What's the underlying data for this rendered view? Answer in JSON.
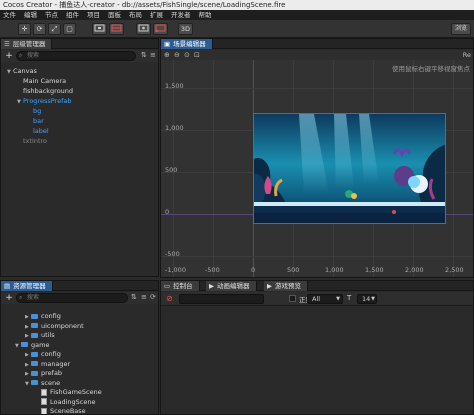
{
  "window": {
    "title": "Cocos Creator - 捕鱼达人-creator - db://assets/FishSingle/scene/LoadingScene.fire"
  },
  "menu": [
    "文件",
    "编辑",
    "节点",
    "组件",
    "项目",
    "面板",
    "布局",
    "扩展",
    "开发者",
    "帮助"
  ],
  "toolbar": {
    "move_icon": "✛",
    "rotate_icon": "⟳",
    "scale_icon": "⤢",
    "rect_icon": "▢",
    "mode_3d_label": "3D",
    "open_label": "浏览"
  },
  "hierarchy": {
    "tab_label": "层级管理器",
    "search_placeholder": "搜索",
    "items": [
      {
        "label": "Canvas",
        "level": 1,
        "expanded": true,
        "color": "white"
      },
      {
        "label": "Main Camera",
        "level": 2,
        "color": "white"
      },
      {
        "label": "fishbackground",
        "level": 2,
        "color": "white"
      },
      {
        "label": "ProgressPrefab",
        "level": 2,
        "expanded": true,
        "color": "blue"
      },
      {
        "label": "bg",
        "level": 3,
        "color": "blue"
      },
      {
        "label": "bar",
        "level": 3,
        "color": "blue"
      },
      {
        "label": "label",
        "level": 3,
        "color": "blue"
      },
      {
        "label": "txtIntro",
        "level": 2,
        "color": "grey"
      }
    ]
  },
  "scene": {
    "tab_label": "场景编辑器",
    "hint": "使用鼠标右键平移视窗焦点",
    "tool_hint": "Re",
    "y_labels": [
      "1,500",
      "1,000",
      "500",
      "0",
      "-500"
    ],
    "x_labels": [
      "-1,000",
      "-500",
      "0",
      "500",
      "1,000",
      "1,500",
      "2,000",
      "2,500"
    ]
  },
  "assets": {
    "tab_label": "资源管理器",
    "search_placeholder": "搜索",
    "items": [
      {
        "label": "config",
        "level": 2,
        "type": "folder"
      },
      {
        "label": "uicomponent",
        "level": 2,
        "type": "folder"
      },
      {
        "label": "utils",
        "level": 2,
        "type": "folder"
      },
      {
        "label": "game",
        "level": 1,
        "type": "folder",
        "expanded": true
      },
      {
        "label": "config",
        "level": 2,
        "type": "folder"
      },
      {
        "label": "manager",
        "level": 2,
        "type": "folder"
      },
      {
        "label": "prefab",
        "level": 2,
        "type": "folder"
      },
      {
        "label": "scene",
        "level": 2,
        "type": "folder",
        "expanded": true
      },
      {
        "label": "FishGameScene",
        "level": 3,
        "type": "scene"
      },
      {
        "label": "LoadingScene",
        "level": 3,
        "type": "scene"
      },
      {
        "label": "SceneBase",
        "level": 3,
        "type": "scene"
      }
    ]
  },
  "bottom_tabs": {
    "console": "控制台",
    "animation": "动画编辑器",
    "preview": "游戏预览"
  },
  "console": {
    "regex_label": "正则",
    "filter_value": "All",
    "font_icon": "T",
    "font_size": "14"
  },
  "colors": {
    "accent_blue": "#2c5c94",
    "node_blue": "#3fa3ff",
    "canvas_border": "#c0329a"
  }
}
